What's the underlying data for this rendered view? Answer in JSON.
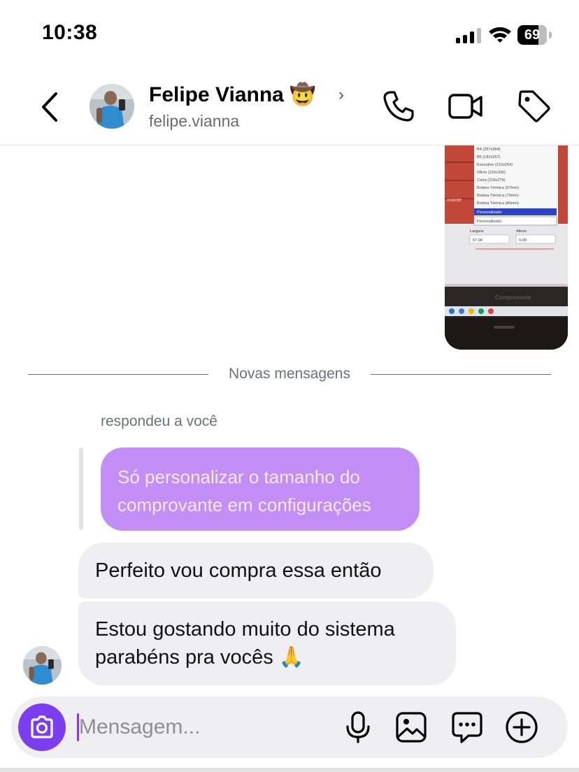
{
  "status_bar": {
    "time": "10:38",
    "battery": "69",
    "icons": [
      "cellular-signal-icon",
      "wifi-icon",
      "battery-icon"
    ]
  },
  "header": {
    "name": "Felipe Vianna",
    "name_emoji": "🤠",
    "username": "felipe.vianna",
    "icons": [
      "back-chevron-icon",
      "chevron-right-icon",
      "phone-icon",
      "video-camera-icon",
      "tag-icon"
    ]
  },
  "photo_message": {
    "menu_items": [
      "B4 (257x364)",
      "B5 (182x257)",
      "Executivo (210x254)",
      "Oficio (216x330)",
      "Carta (216x279)",
      "Bobina Térmica (57mm)",
      "Bobina Térmica (76mm)",
      "Bobina Térmica (80mm)",
      "Personalizado"
    ],
    "select_value": "Personalizado",
    "side_label": "ovante",
    "largura_label": "Largura",
    "altura_label": "Altura",
    "largura_value": "57.00",
    "altura_value": "0.00",
    "comprovante_label": "Comprovante"
  },
  "divider": {
    "text": "Novas mensagens"
  },
  "reply": {
    "label": "respondeu a você",
    "quoted_text": "Só personalizar o tamanho do comprovante em configurações"
  },
  "messages": [
    {
      "text": "Perfeito vou compra essa então"
    },
    {
      "text": "Estou gostando muito do sistema parabéns pra vocês 🙏"
    }
  ],
  "composer": {
    "placeholder": "Mensagem...",
    "icons": [
      "camera-icon",
      "microphone-icon",
      "gallery-icon",
      "sticker-chat-icon",
      "add-icon"
    ]
  },
  "colors": {
    "accent": "#7b3df0",
    "reply_bubble": "#c38ef5",
    "bubble_bg": "#efeff2",
    "muted_text": "#6b7079"
  }
}
